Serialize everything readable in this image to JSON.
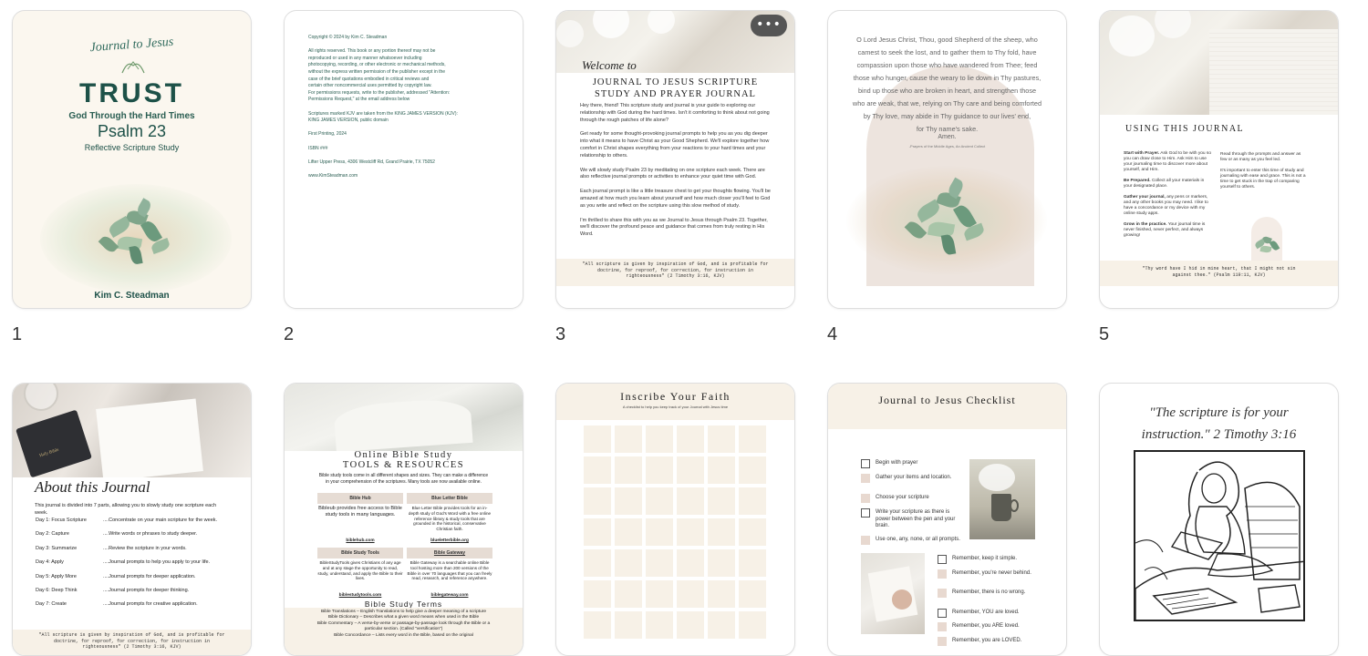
{
  "pages": [
    {
      "number": "1",
      "journal_script": "Journal to Jesus",
      "title": "TRUST",
      "subtitle": "God Through the Hard Times",
      "psalm": "Psalm 23",
      "study": "Reflective Scripture Study",
      "author": "Kim C. Steadman",
      "colors": {
        "title": "#1d5148",
        "accent": "#6f9a6c"
      }
    },
    {
      "number": "2",
      "lines": [
        "Copyright © 2024 by Kim C. Steadman",
        "",
        "All rights reserved. This book or any portion thereof may not be",
        "reproduced or used in any manner whatsoever including",
        "photocopying, recording, or other electronic or mechanical methods,",
        "without the express written permission of the publisher except in the",
        "case of the brief quotations embodied in critical reviews and",
        "certain other noncommercial uses permitted by copyright law.",
        "For permissions requests, write to the publisher, addressed \"Attention:",
        "Permissions Request,\" at the email address below",
        "",
        "Scriptures marked KJV are taken from the KING JAMES VERSION (KJV):",
        "KING JAMES VERSION, public domain",
        "",
        "First Printing, 2024",
        "",
        "ISBN  ###",
        "",
        "Lifter Upper Press, 4306 Westcliff Rd, Grand Prairie, TX 75052",
        "",
        "www.KimSteadman.com"
      ],
      "color": "#2a5e52"
    },
    {
      "number": "3",
      "more_button": "•••",
      "welcome": "Welcome to",
      "heading_line1": "JOURNAL TO JESUS SCRIPTURE",
      "heading_line2": "STUDY AND PRAYER JOURNAL",
      "paragraphs": [
        "Hey there, friend! This scripture study and journal is your guide to exploring our relationship with God during the hard times. Isn't it comforting to think about not going through the rough patches of life alone?",
        "Get ready for some thought-provoking journal prompts to help you as you dig deeper into what it means to have Christ as your Good Shepherd. We'll explore together how comfort in Christ shapes everything from your reactions to your hard times and your relationship to others.",
        "We will slowly study Psalm 23 by meditating on one scripture each week. There are also reflective journal prompts or activities to enhance your quiet time with God.",
        "Each journal prompt is like a little treasure chest to get your thoughts flowing. You'll be amazed at how much you learn about yourself and how much closer you'll feel to God as you write and reflect on the scripture using this slow method of study.",
        "I'm thrilled to share this with you as we Journal to Jesus through Psalm 23. Together, we'll discover the profound peace and guidance that comes from truly resting in His Word."
      ],
      "footer": "\"All scripture is given by inspiration of God, and is profitable for doctrine, for reproof, for correction, for instruction in righteousness\" (2 Timothy 3:16, KJV)"
    },
    {
      "number": "4",
      "prayer_lines": [
        "O Lord Jesus Christ, Thou, good Shepherd of the sheep, who",
        "camest to seek the lost, and to gather them to Thy fold, have",
        "compassion upon those who have wandered from Thee; feed",
        "those who hunger, cause the weary to lie down in Thy pastures,",
        "bind up those who are broken in heart, and strengthen those",
        "who are weak, that we, relying on Thy care and being comforted",
        "by Thy love, may abide in Thy guidance to our lives' end,",
        "for Thy name's sake."
      ],
      "amen": "Amen.",
      "source": "-Prayers of the Middle Ages, An Ancient Collect"
    },
    {
      "number": "5",
      "heading": "USING THIS JOURNAL",
      "left_items": [
        {
          "bold": "Start with Prayer.",
          "text": " Ask God to be with you so you can draw close to Him. Ask Him to use your journaling time to discover more about yourself, and Him."
        },
        {
          "bold": "Be Prepared.",
          "text": " Collect all your materials in your designated place."
        },
        {
          "bold": "Gather your journal,",
          "text": " any pens or markers, and any other books you may need. I like to have a concordance or my device with my online study apps."
        },
        {
          "bold": "Grow in the practice.",
          "text": " Your journal time is never finished, never perfect, and always growing!"
        }
      ],
      "right_items": [
        "Read through the prompts and answer as few or as many as you feel led.",
        "It's important to enter this time of study and journaling with ease and grace. This is not a time to get stuck in the trap of comparing yourself to others."
      ],
      "footer": "\"Thy word have I hid in mine heart, that I might not sin against thee.\" (Psalm 119:11, KJV)"
    },
    {
      "number": "",
      "bible_label": "Holy Bible",
      "heading": "About this Journal",
      "intro": "This journal is divided into 7 parts, allowing you to slowly study one scripture each week.",
      "days": [
        {
          "day": "Day 1: Focus Scripture",
          "desc": "....Concentrate on your main scripture for the week."
        },
        {
          "day": "Day 2: Capture",
          "desc": "....Write words or phrases to study deeper."
        },
        {
          "day": "Day 3: Summarize",
          "desc": "....Review the scripture in your words."
        },
        {
          "day": "Day 4: Apply",
          "desc": "....Journal prompts to help you apply to your life."
        },
        {
          "day": "Day 5: Apply More",
          "desc": "....Journal prompts for deeper application."
        },
        {
          "day": "Day 6: Deep Think",
          "desc": "....Journal prompts for deeper thinking."
        },
        {
          "day": "Day 7: Create",
          "desc": "....Journal prompts for creative application."
        }
      ],
      "footer": "\"All scripture is given by inspiration of God, and is profitable for doctrine, for reproof, for correction, for instruction in righteousness\" (2 Timothy 3:16, KJV)"
    },
    {
      "number": "",
      "heading_line1": "Online Bible Study",
      "heading_line2": "TOOLS & RESOURCES",
      "intro": "Bible study tools come in all different shapes and sizes. They can make a difference in your comprehension of the scriptures. Many tools are now available online.",
      "tools": [
        {
          "name": "Bible Hub",
          "desc": "Bibleub provides free access to Bible study tools in many languages.",
          "link": "biblehub.com"
        },
        {
          "name": "Blue Letter Bible",
          "desc": "Blue Letter Bible provides tools for an in-depth study of God's Word with a free online reference library & study tools that are grounded in the historical, conservative Christian faith.",
          "link": "blueletterbible.org"
        },
        {
          "name": "Bible Study Tools",
          "desc": "BibleStudyTools gives Christians of any age and at any stage the opportunity to read, study, understand, and apply the Bible to their lives.",
          "link": "biblestudytools.com"
        },
        {
          "name": "Bible Gateway",
          "desc": "Bible Gateway is a searchable online Bible tool hosting more than 200 versions of the Bible in over 70 languages that you can freely read, research, and reference anywhere.",
          "link": "biblegateway.com"
        }
      ],
      "terms_heading": "Bible Study Terms",
      "terms": [
        "Bible Translations – English Translations to help give a deeper meaning of a scripture",
        "Bible Dictionary – Describes what a given word means when used in the Bible",
        "Bible Commentary – A verse-by-verse or passage-by-passage look through the Bible or a particular section. (Called \"versification\")",
        "Bible Concordance – Lists every word in the Bible, based on the original"
      ]
    },
    {
      "number": "",
      "heading": "Inscribe Your Faith",
      "subheading": "A checklist to help you keep track of your Journal with Jesus time"
    },
    {
      "number": "",
      "heading": "Journal to Jesus Checklist",
      "items_top": [
        {
          "label": "Begin with prayer",
          "style": "outline"
        },
        {
          "label": "Gather your items and location.",
          "style": "fill"
        },
        {
          "label": "Choose your scripture",
          "style": "fill"
        },
        {
          "label": "Write your scripture as there is power between the pen and your brain.",
          "style": "outline"
        },
        {
          "label": "Use one, any, none, or all prompts.",
          "style": "fill"
        },
        {
          "label": "End in gratitude.",
          "style": "fill"
        }
      ],
      "items_bottom": [
        {
          "label": "Remember, keep it simple.",
          "style": "outline"
        },
        {
          "label": "Remember, you're never behind.",
          "style": "fill"
        },
        {
          "label": "Remember, there is no wrong.",
          "style": "fill"
        },
        {
          "label": "Remember, YOU are loved.",
          "style": "outline"
        },
        {
          "label": "Remember, you ARE loved.",
          "style": "fill"
        },
        {
          "label": "Remember, you are LOVED.",
          "style": "fill"
        }
      ]
    },
    {
      "number": "",
      "quote_line1": "\"The scripture is for your",
      "quote_line2": "instruction.\" 2 Timothy 3:16"
    }
  ]
}
